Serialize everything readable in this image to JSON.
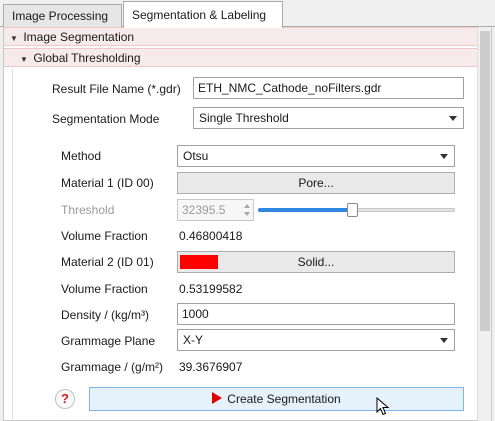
{
  "tabs": [
    {
      "label": "Image Processing",
      "active": false
    },
    {
      "label": "Segmentation & Labeling",
      "active": true
    }
  ],
  "sections": {
    "image_segmentation": "Image Segmentation",
    "global_thresholding": "Global Thresholding"
  },
  "form": {
    "result_file_label": "Result File Name (*.gdr)",
    "result_file_value": "ETH_NMC_Cathode_noFilters.gdr",
    "seg_mode_label": "Segmentation Mode",
    "seg_mode_value": "Single Threshold",
    "method_label": "Method",
    "method_value": "Otsu",
    "material1_label": "Material 1 (ID 00)",
    "material1_button": "Pore...",
    "threshold_label": "Threshold",
    "threshold_value": "32395.5",
    "threshold_slider_fraction": 0.48,
    "vf1_label": "Volume Fraction",
    "vf1_value": "0.46800418",
    "material2_label": "Material 2 (ID 01)",
    "material2_button": "Solid...",
    "material2_color": "#ff0000",
    "vf2_label": "Volume Fraction",
    "vf2_value": "0.53199582",
    "density_label": "Density / (kg/m³)",
    "density_value": "1000",
    "grammage_plane_label": "Grammage Plane",
    "grammage_plane_value": "X-Y",
    "grammage_label": "Grammage / (g/m²)",
    "grammage_value": "39.3676907"
  },
  "actions": {
    "help_label": "?",
    "create_label": "Create Segmentation"
  },
  "colors": {
    "accent": "#2f87e0",
    "play_icon": "#e00000",
    "help_icon": "#d02020"
  }
}
